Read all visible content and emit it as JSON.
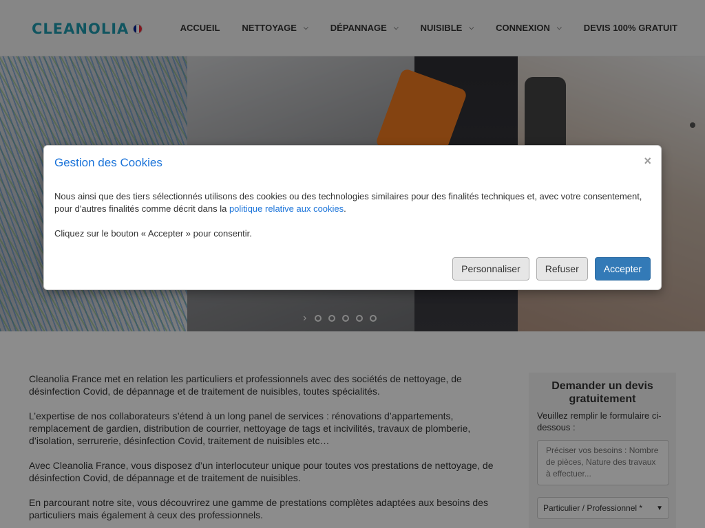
{
  "logo": {
    "text": "CLEANOLIA",
    "flag_colors": [
      "#002395",
      "#ffffff",
      "#ed2939"
    ]
  },
  "nav": [
    {
      "label": "ACCUEIL",
      "has_dropdown": false
    },
    {
      "label": "NETTOYAGE",
      "has_dropdown": true
    },
    {
      "label": "DÉPANNAGE",
      "has_dropdown": true
    },
    {
      "label": "NUISIBLE",
      "has_dropdown": true
    },
    {
      "label": "CONNEXION",
      "has_dropdown": true
    },
    {
      "label": "DEVIS 100% GRATUIT",
      "has_dropdown": false
    }
  ],
  "slider": {
    "dot_count": 5,
    "arrow_icon": "chevron-right-icon"
  },
  "content": {
    "paragraphs": [
      "Cleanolia France met en relation les particuliers et professionnels avec des sociétés de nettoyage, de désinfection Covid, de dépannage et de traitement de nuisibles, toutes spécialités.",
      "L’expertise de nos collaborateurs s’étend à un long panel de services : rénovations d’appartements, remplacement de gardien, distribution de courrier, nettoyage de tags et incivilités, travaux de plomberie, d’isolation, serrurerie, désinfection Covid, traitement de nuisibles etc…",
      "Avec Cleanolia France, vous disposez d’un interlocuteur unique pour toutes vos prestations de nettoyage, de désinfection Covid, de dépannage et de traitement de nuisibles.",
      "En parcourant notre site, vous découvrirez une gamme de prestations complètes adaptées aux besoins des particuliers mais également à ceux des professionnels."
    ]
  },
  "quote": {
    "title": "Demander un devis gratuitement",
    "text": "Veuillez remplir le formulaire ci-dessous :",
    "textarea_placeholder": "Préciser vos besoins : Nombre de pièces, Nature des travaux à effectuer...",
    "select_value": "Particulier / Professionnel *"
  },
  "modal": {
    "title": "Gestion des Cookies",
    "close_symbol": "×",
    "body_prefix": "Nous ainsi que des tiers sélectionnés utilisons des cookies ou des technologies similaires pour des finalités techniques et, avec votre consentement, pour d'autres finalités comme décrit dans la",
    "body_link": "politique relative aux cookies",
    "body_suffix": ".",
    "instruction": "Cliquez sur le bouton « Accepter » pour consentir.",
    "buttons": {
      "customize": "Personnaliser",
      "refuse": "Refuser",
      "accept": "Accepter"
    }
  },
  "colors": {
    "link": "#1a73d9",
    "primary_button": "#337ab7",
    "logo": "#1f9bb0"
  }
}
